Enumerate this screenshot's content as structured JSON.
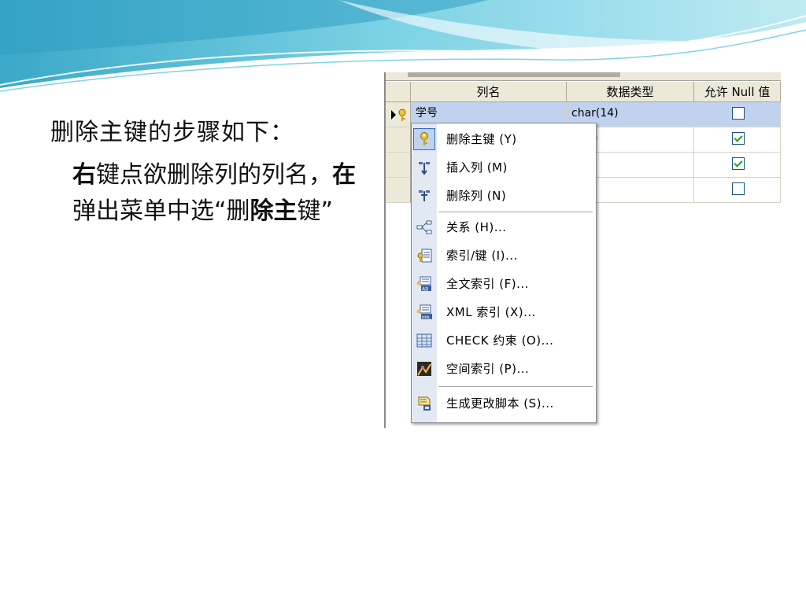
{
  "slide": {
    "title_line": "删除主键的步骤如下：",
    "body_bold_1": "右",
    "body_1": "键点欲删除列的列名，",
    "body_bold_2": "在",
    "body_2": "弹出菜单中选“删",
    "body_bold_3": "除主",
    "body_3": "键”"
  },
  "grid": {
    "headers": [
      "列名",
      "数据类型",
      "允许 Null 值"
    ],
    "rows": [
      {
        "name": "学号",
        "type": "char(14)",
        "allow_null": false,
        "selected": true
      },
      {
        "name": "",
        "type": "r(8)",
        "allow_null": true,
        "selected": false
      },
      {
        "name": "",
        "type": "",
        "allow_null": true,
        "selected": false
      },
      {
        "name": "",
        "type": "",
        "allow_null": false,
        "selected": false
      }
    ]
  },
  "menu": {
    "items": [
      {
        "label": "删除主键 (Y)",
        "icon": "key-icon"
      },
      {
        "label": "插入列 (M)",
        "icon": "insert-column-icon"
      },
      {
        "label": "删除列 (N)",
        "icon": "delete-column-icon"
      },
      {
        "label": "关系 (H)...",
        "icon": "relationship-icon"
      },
      {
        "label": "索引/键 (I)...",
        "icon": "index-key-icon"
      },
      {
        "label": "全文索引 (F)...",
        "icon": "fulltext-index-icon"
      },
      {
        "label": "XML 索引 (X)...",
        "icon": "xml-index-icon"
      },
      {
        "label": "CHECK 约束 (O)...",
        "icon": "check-constraint-icon"
      },
      {
        "label": "空间索引 (P)...",
        "icon": "spatial-index-icon"
      },
      {
        "label": "生成更改脚本 (S)...",
        "icon": "generate-script-icon"
      }
    ]
  },
  "colors": {
    "wave_light": "#bfeaf2",
    "wave_mid": "#7fd3e6",
    "wave_dark": "#3aa8c8",
    "selection": "#c1d2ee",
    "menu_gutter": "#e3e9f2"
  }
}
